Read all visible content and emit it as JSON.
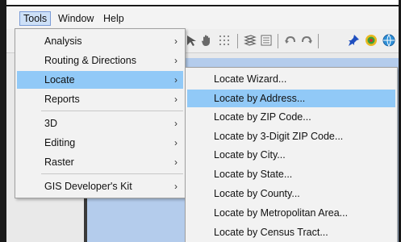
{
  "menubar": {
    "items": [
      {
        "label": "Tools"
      },
      {
        "label": "Window"
      },
      {
        "label": "Help"
      }
    ]
  },
  "tools_menu": {
    "items": [
      {
        "label": "Analysis",
        "arrow": "›"
      },
      {
        "label": "Routing & Directions",
        "arrow": "›"
      },
      {
        "label": "Locate",
        "arrow": "›"
      },
      {
        "label": "Reports",
        "arrow": "›"
      },
      {
        "label": "3D",
        "arrow": "›"
      },
      {
        "label": "Editing",
        "arrow": "›"
      },
      {
        "label": "Raster",
        "arrow": "›"
      },
      {
        "label": "GIS Developer's Kit",
        "arrow": "›"
      }
    ]
  },
  "locate_submenu": {
    "items": [
      {
        "label": "Locate Wizard..."
      },
      {
        "label": "Locate by Address..."
      },
      {
        "label": "Locate by ZIP Code..."
      },
      {
        "label": "Locate by 3-Digit ZIP Code..."
      },
      {
        "label": "Locate by City..."
      },
      {
        "label": "Locate by State..."
      },
      {
        "label": "Locate by County..."
      },
      {
        "label": "Locate by Metropolitan Area..."
      },
      {
        "label": "Locate by Census Tract..."
      }
    ]
  },
  "toolbar": {
    "icons": [
      "hand-icon",
      "grid-icon",
      "layers-icon",
      "list-icon",
      "undo-icon",
      "redo-icon",
      "pin-icon",
      "target-icon",
      "globe-icon"
    ]
  },
  "colors": {
    "highlight": "#91c9f7",
    "menu_background": "#f2f2f2",
    "map_background": "#b4ccec"
  }
}
